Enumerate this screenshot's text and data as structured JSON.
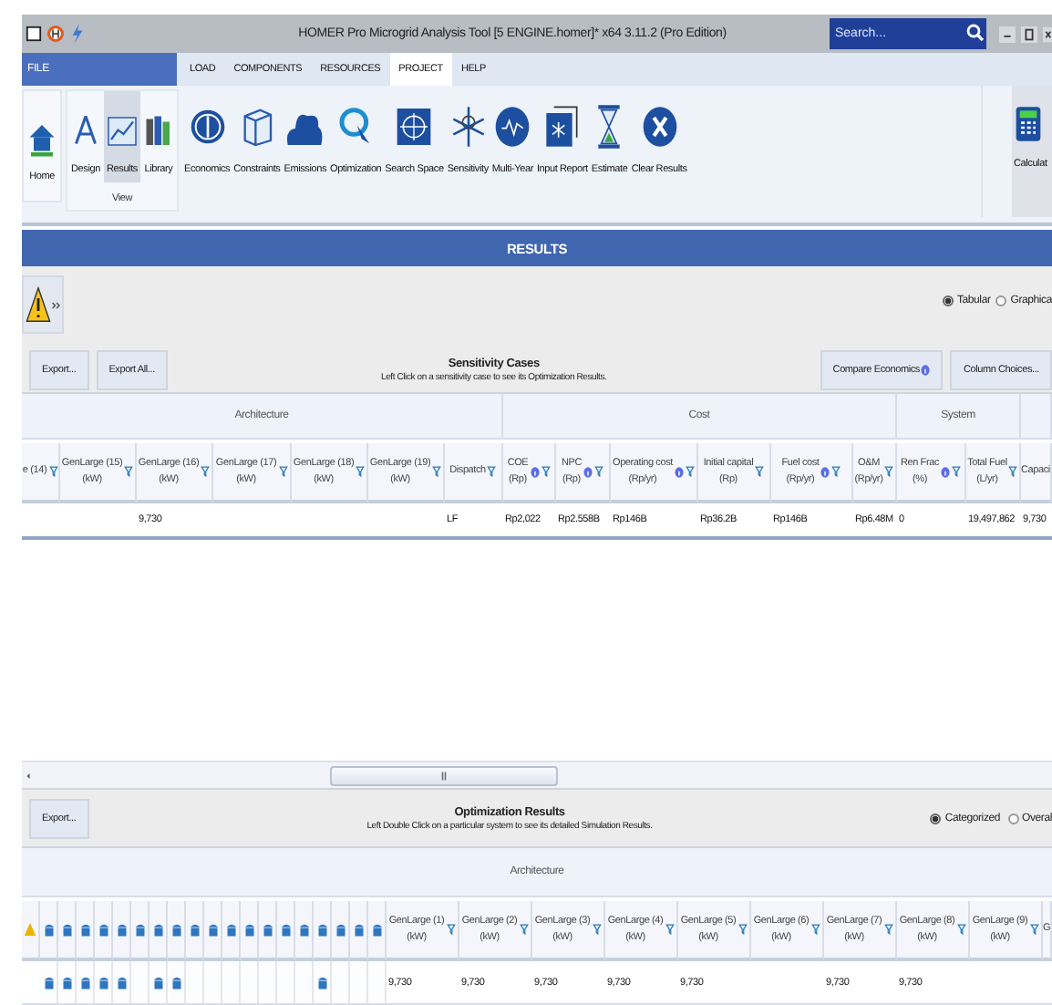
{
  "title_bar": {
    "title": "HOMER Pro Microgrid Analysis Tool [5 ENGINE.homer]*  x64 3.11.2 (Pro Edition)",
    "search": {
      "placeholder": "Search..."
    }
  },
  "menu": {
    "file": "FILE",
    "tabs": [
      {
        "label": "LOAD",
        "selected": false
      },
      {
        "label": "COMPONENTS",
        "selected": false
      },
      {
        "label": "RESOURCES",
        "selected": false
      },
      {
        "label": "PROJECT",
        "selected": true
      },
      {
        "label": "HELP",
        "selected": false
      }
    ]
  },
  "ribbon": {
    "home": {
      "label": "Home",
      "kind": "house"
    },
    "view_group": {
      "label": "View",
      "items": [
        {
          "label": "Design",
          "kind": "design",
          "selected": false
        },
        {
          "label": "Results",
          "kind": "results",
          "selected": true
        },
        {
          "label": "Library",
          "kind": "library",
          "selected": false
        }
      ]
    },
    "tools": [
      {
        "label": "Economics",
        "kind": "economics"
      },
      {
        "label": "Constraints",
        "kind": "constraints"
      },
      {
        "label": "Emissions",
        "kind": "emissions"
      },
      {
        "label": "Optimization",
        "kind": "optimization"
      },
      {
        "label": "Search Space",
        "kind": "search_space"
      },
      {
        "label": "Sensitivity",
        "kind": "sensitivity"
      },
      {
        "label": "Multi-Year",
        "kind": "multi_year"
      },
      {
        "label": "Input Report",
        "kind": "input_report"
      },
      {
        "label": "Estimate",
        "kind": "estimate"
      },
      {
        "label": "Clear Results",
        "kind": "clear"
      }
    ],
    "calculate": {
      "label": "Calculat",
      "kind": "calculator"
    }
  },
  "results": {
    "title": "RESULTS",
    "view_options": [
      {
        "label": "Tabular",
        "selected": true
      },
      {
        "label": "Graphica",
        "selected": false
      }
    ],
    "sensitivity": {
      "buttons_left": [
        "Export...",
        "Export All..."
      ],
      "title": "Sensitivity Cases",
      "subtitle": "Left Click on a sensitivity case to see its Optimization Results.",
      "buttons_right": [
        {
          "label": "Compare Economics",
          "info": true
        },
        {
          "label": "Column Choices...",
          "info": false
        }
      ],
      "groups": [
        {
          "label": "Architecture",
          "columns": [
            {
              "title": "e (14)",
              "info": false,
              "filter": true
            },
            {
              "title": "GenLarge (15)",
              "unit": "(kW)",
              "info": false,
              "filter": true
            },
            {
              "title": "GenLarge (16)",
              "unit": "(kW)",
              "info": false,
              "filter": true
            },
            {
              "title": "GenLarge (17)",
              "unit": "(kW)",
              "info": false,
              "filter": true
            },
            {
              "title": "GenLarge (18)",
              "unit": "(kW)",
              "info": false,
              "filter": true
            },
            {
              "title": "GenLarge (19)",
              "unit": "(kW)",
              "info": false,
              "filter": true
            },
            {
              "title": "Dispatch",
              "info": false,
              "filter": true
            }
          ]
        },
        {
          "label": "Cost",
          "columns": [
            {
              "title": "COE",
              "unit": "(Rp)",
              "info": true,
              "filter": true
            },
            {
              "title": "NPC",
              "unit": "(Rp)",
              "info": true,
              "filter": true
            },
            {
              "title": "Operating cost",
              "unit": "(Rp/yr)",
              "info": true,
              "filter": true
            },
            {
              "title": "Initial capital",
              "unit": "(Rp)",
              "info": false,
              "filter": true
            },
            {
              "title": "Fuel cost",
              "unit": "(Rp/yr)",
              "info": true,
              "filter": true
            },
            {
              "title": "O&M",
              "unit": "(Rp/yr)",
              "info": false,
              "filter": true
            }
          ]
        },
        {
          "label": "System",
          "columns": [
            {
              "title": "Ren Frac",
              "unit": "(%)",
              "info": true,
              "filter": true
            },
            {
              "title": "Total Fuel",
              "unit": "(L/yr)",
              "info": false,
              "filter": true
            }
          ]
        },
        {
          "columns": [
            {
              "title": "Capaci",
              "info": false,
              "filter": false
            }
          ]
        }
      ],
      "rows": [
        [
          null,
          null,
          "9,730",
          null,
          null,
          null,
          "LF",
          "Rp2,022",
          "Rp2.558B",
          "Rp146B",
          "Rp36.2B",
          "Rp146B",
          "Rp6.48M",
          "0",
          "19,497,862",
          "9,730"
        ]
      ]
    },
    "optimization": {
      "buttons_left": [
        "Export..."
      ],
      "title": "Optimization Results",
      "subtitle": "Left Double Click on a particular system to see its detailed Simulation Results.",
      "view_options": [
        {
          "label": "Categorized",
          "selected": true
        },
        {
          "label": "Overal",
          "selected": false
        }
      ],
      "groups": [
        {
          "label": "Architecture"
        }
      ],
      "columns": [
        {
          "title": "GenLarge (1)",
          "unit": "(kW)",
          "filter": true
        },
        {
          "title": "GenLarge (2)",
          "unit": "(kW)",
          "filter": true
        },
        {
          "title": "GenLarge (3)",
          "unit": "(kW)",
          "filter": true
        },
        {
          "title": "GenLarge (4)",
          "unit": "(kW)",
          "filter": true
        },
        {
          "title": "GenLarge (5)",
          "unit": "(kW)",
          "filter": true
        },
        {
          "title": "GenLarge (6)",
          "unit": "(kW)",
          "filter": true
        },
        {
          "title": "GenLarge (7)",
          "unit": "(kW)",
          "filter": true
        },
        {
          "title": "GenLarge (8)",
          "unit": "(kW)",
          "filter": true
        },
        {
          "title": "GenLarge (9)",
          "unit": "(kW)",
          "filter": true
        },
        {
          "title": "G",
          "filter": false
        }
      ],
      "rows": [
        {
          "generators": [
            true,
            true,
            true,
            true,
            true,
            false,
            true,
            true,
            false,
            false,
            false,
            false,
            false,
            false,
            false,
            true,
            false,
            false,
            false
          ],
          "cells": [
            "9,730",
            "9,730",
            "9,730",
            "9,730",
            "9,730",
            null,
            "9,730",
            "9,730",
            null,
            null
          ]
        }
      ]
    }
  }
}
